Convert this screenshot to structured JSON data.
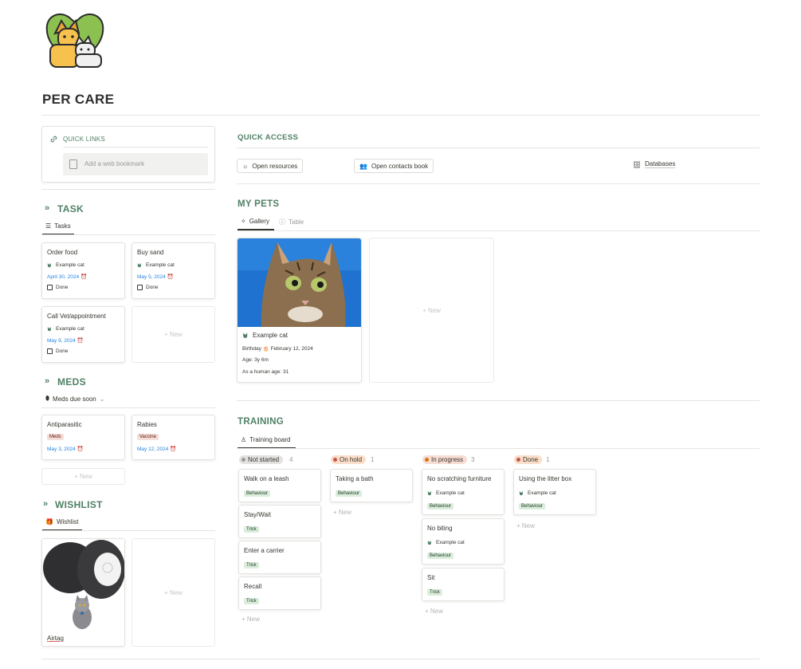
{
  "page": {
    "title": "PER CARE"
  },
  "quick_links": {
    "title": "QUICK LINKS",
    "bookmark_placeholder": "Add a web bookmark"
  },
  "quick_access": {
    "title": "QUICK ACCESS",
    "buttons": [
      "Open resources",
      "Open contacts book",
      "Databases"
    ]
  },
  "task": {
    "title": "TASK",
    "view_tab": "Tasks",
    "cards": [
      {
        "title": "Order food",
        "pet": "Example cat",
        "date": "April 30, 2024",
        "done_label": "Done"
      },
      {
        "title": "Buy sand",
        "pet": "Example cat",
        "date": "May 5, 2024",
        "done_label": "Done"
      },
      {
        "title": "Call Vet/appointment",
        "pet": "Example cat",
        "date": "May 9, 2024",
        "done_label": "Done"
      }
    ],
    "new_label": "+ New"
  },
  "meds": {
    "title": "MEDS",
    "view_tab": "Meds due soon",
    "cards": [
      {
        "title": "Antiparasitic",
        "tag": "Meds",
        "date": "May 3, 2024"
      },
      {
        "title": "Rabies",
        "tag": "Vaccine",
        "date": "May 12, 2024"
      }
    ],
    "new_label": "+ New"
  },
  "wishlist": {
    "title": "WISHLIST",
    "view_tab": "Wishlist",
    "cards": [
      {
        "title": "Airtag"
      }
    ],
    "new_label": "+ New"
  },
  "my_pets": {
    "title": "MY PETS",
    "tabs": [
      "Gallery",
      "Table"
    ],
    "pet": {
      "name": "Example cat",
      "birthday_label": "Birthday",
      "birthday": "February 12, 2024",
      "age": "Age: 3y 6m",
      "human_age": "As a human age: 31"
    },
    "new_label": "+ New"
  },
  "training": {
    "title": "TRAINING",
    "view_tab": "Training board",
    "columns": [
      {
        "name": "Not started",
        "count": "4",
        "color": "#9b9a97",
        "bg": "#e3e2e0",
        "cards": [
          {
            "title": "Walk on a leash",
            "tag": "Behaviour"
          },
          {
            "title": "Stay/Wait",
            "tag": "Trick"
          },
          {
            "title": "Enter a carrier",
            "tag": "Trick"
          },
          {
            "title": "Recall",
            "tag": "Trick"
          }
        ]
      },
      {
        "name": "On hold",
        "count": "1",
        "color": "#c4554d",
        "bg": "#fadec9",
        "cards": [
          {
            "title": "Taking a bath",
            "tag": "Behaviour"
          }
        ]
      },
      {
        "name": "In progress",
        "count": "3",
        "color": "#d9730d",
        "bg": "#f7ddd3",
        "cards": [
          {
            "title": "No scratching furniture",
            "pet": "Example cat",
            "tag": "Behaviour"
          },
          {
            "title": "No biting",
            "pet": "Example cat",
            "tag": "Behaviour"
          },
          {
            "title": "Sit",
            "tag": "Trick"
          }
        ]
      },
      {
        "name": "Done",
        "count": "1",
        "color": "#c4554d",
        "bg": "#fadec9",
        "cards": [
          {
            "title": "Using the litter box",
            "pet": "Example cat",
            "tag": "Behaviour"
          }
        ]
      }
    ],
    "new_label": "+ New"
  },
  "colors": {
    "accent": "#4f8065",
    "date_blue": "#2383e2"
  }
}
